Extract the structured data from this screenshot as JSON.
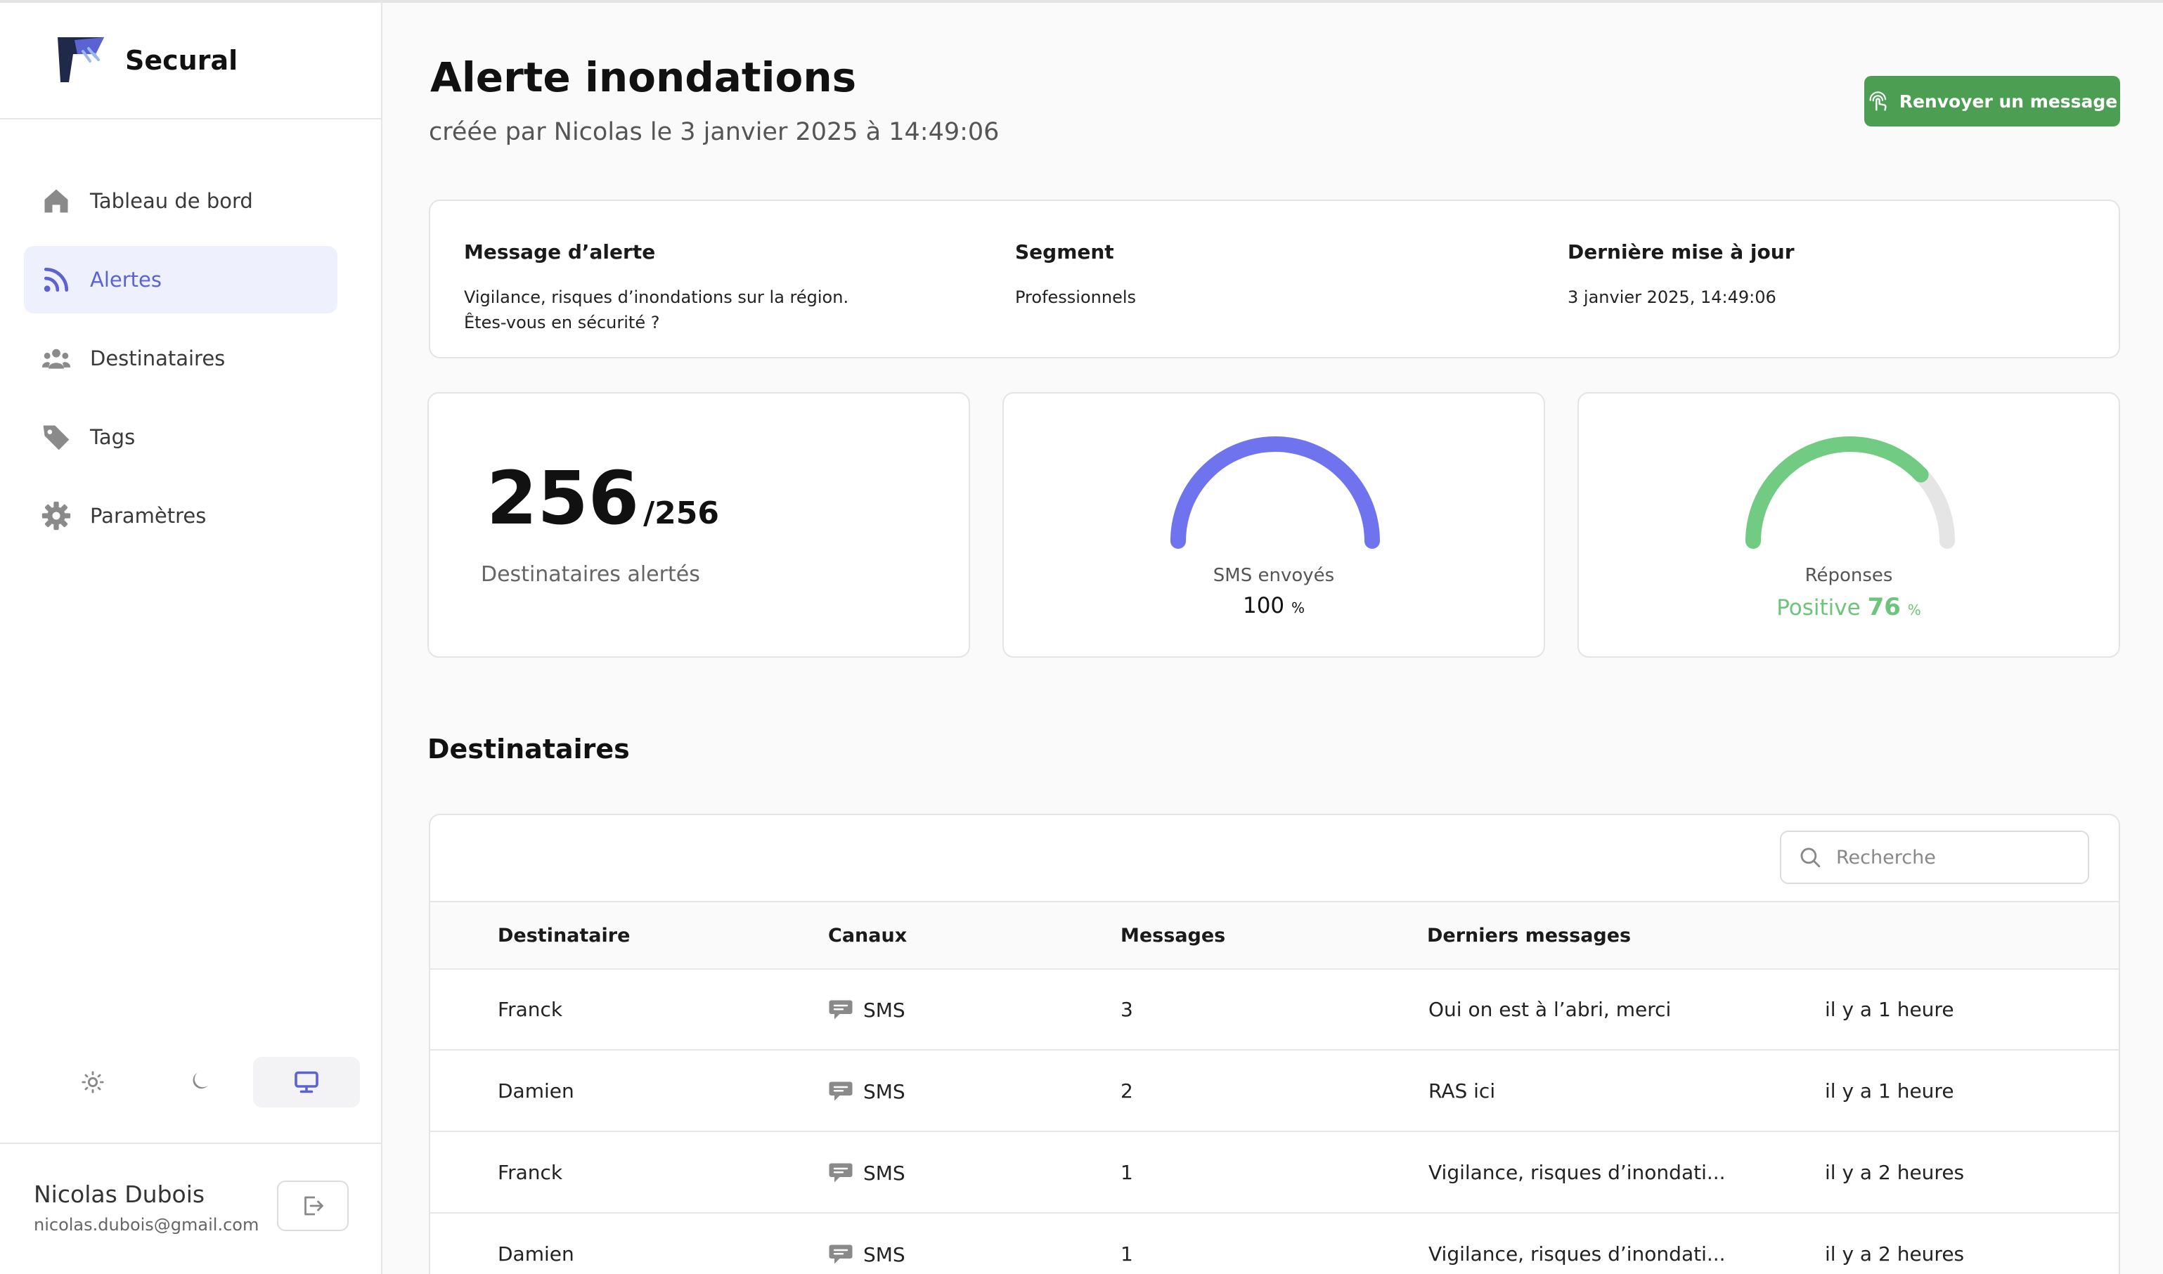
{
  "brand": {
    "name": "Secural"
  },
  "sidebar": {
    "items": [
      {
        "label": "Tableau de bord",
        "icon": "home-icon",
        "active": false
      },
      {
        "label": "Alertes",
        "icon": "rss-icon",
        "active": true
      },
      {
        "label": "Destinataires",
        "icon": "users-icon",
        "active": false
      },
      {
        "label": "Tags",
        "icon": "tag-icon",
        "active": false
      },
      {
        "label": "Paramètres",
        "icon": "gear-icon",
        "active": false
      }
    ],
    "theme": {
      "options": [
        "sun-icon",
        "moon-icon",
        "monitor-icon"
      ],
      "selected": "monitor-icon"
    }
  },
  "user": {
    "name": "Nicolas Dubois",
    "email": "nicolas.dubois@gmail.com"
  },
  "header": {
    "title": "Alerte inondations",
    "subtitle": "créée par Nicolas le 3 janvier 2025 à 14:49:06",
    "resend_label": "Renvoyer un message"
  },
  "info": {
    "message": {
      "label": "Message d’alerte",
      "line1": "Vigilance, risques d’inondations sur la région.",
      "line2": "Êtes-vous en sécurité ?"
    },
    "segment": {
      "label": "Segment",
      "value": "Professionnels"
    },
    "updated": {
      "label": "Dernière mise à jour",
      "value": "3 janvier 2025, 14:49:06"
    }
  },
  "stats": {
    "recipients": {
      "value": "256",
      "total": "/256",
      "caption": "Destinataires alertés"
    },
    "sms": {
      "label": "SMS envoyés",
      "value": "100",
      "unit": "%",
      "fraction": 1.0,
      "color": "#6f73ee"
    },
    "responses": {
      "label": "Réponses",
      "prefix": "Positive",
      "value": "76",
      "unit": "%",
      "fraction": 0.76,
      "color": "#72cb82",
      "track": "#e5e5e5"
    }
  },
  "recipients_section": {
    "title": "Destinataires",
    "search_placeholder": "Recherche",
    "columns": [
      "Destinataire",
      "Canaux",
      "Messages",
      "Derniers messages"
    ],
    "rows": [
      {
        "name": "Franck",
        "channel": "SMS",
        "messages": "3",
        "last": "Oui on est à l’abri, merci",
        "when": "il y a 1 heure"
      },
      {
        "name": "Damien",
        "channel": "SMS",
        "messages": "2",
        "last": "RAS ici",
        "when": "il y a 1 heure"
      },
      {
        "name": "Franck",
        "channel": "SMS",
        "messages": "1",
        "last": "Vigilance, risques d’inondati...",
        "when": "il y a 2 heures"
      },
      {
        "name": "Damien",
        "channel": "SMS",
        "messages": "1",
        "last": "Vigilance, risques d’inondati...",
        "when": "il y a 2 heures"
      }
    ]
  },
  "colors": {
    "accent": "#5b63d3",
    "accent_bg": "#eef0fd",
    "success": "#4c9f52"
  }
}
